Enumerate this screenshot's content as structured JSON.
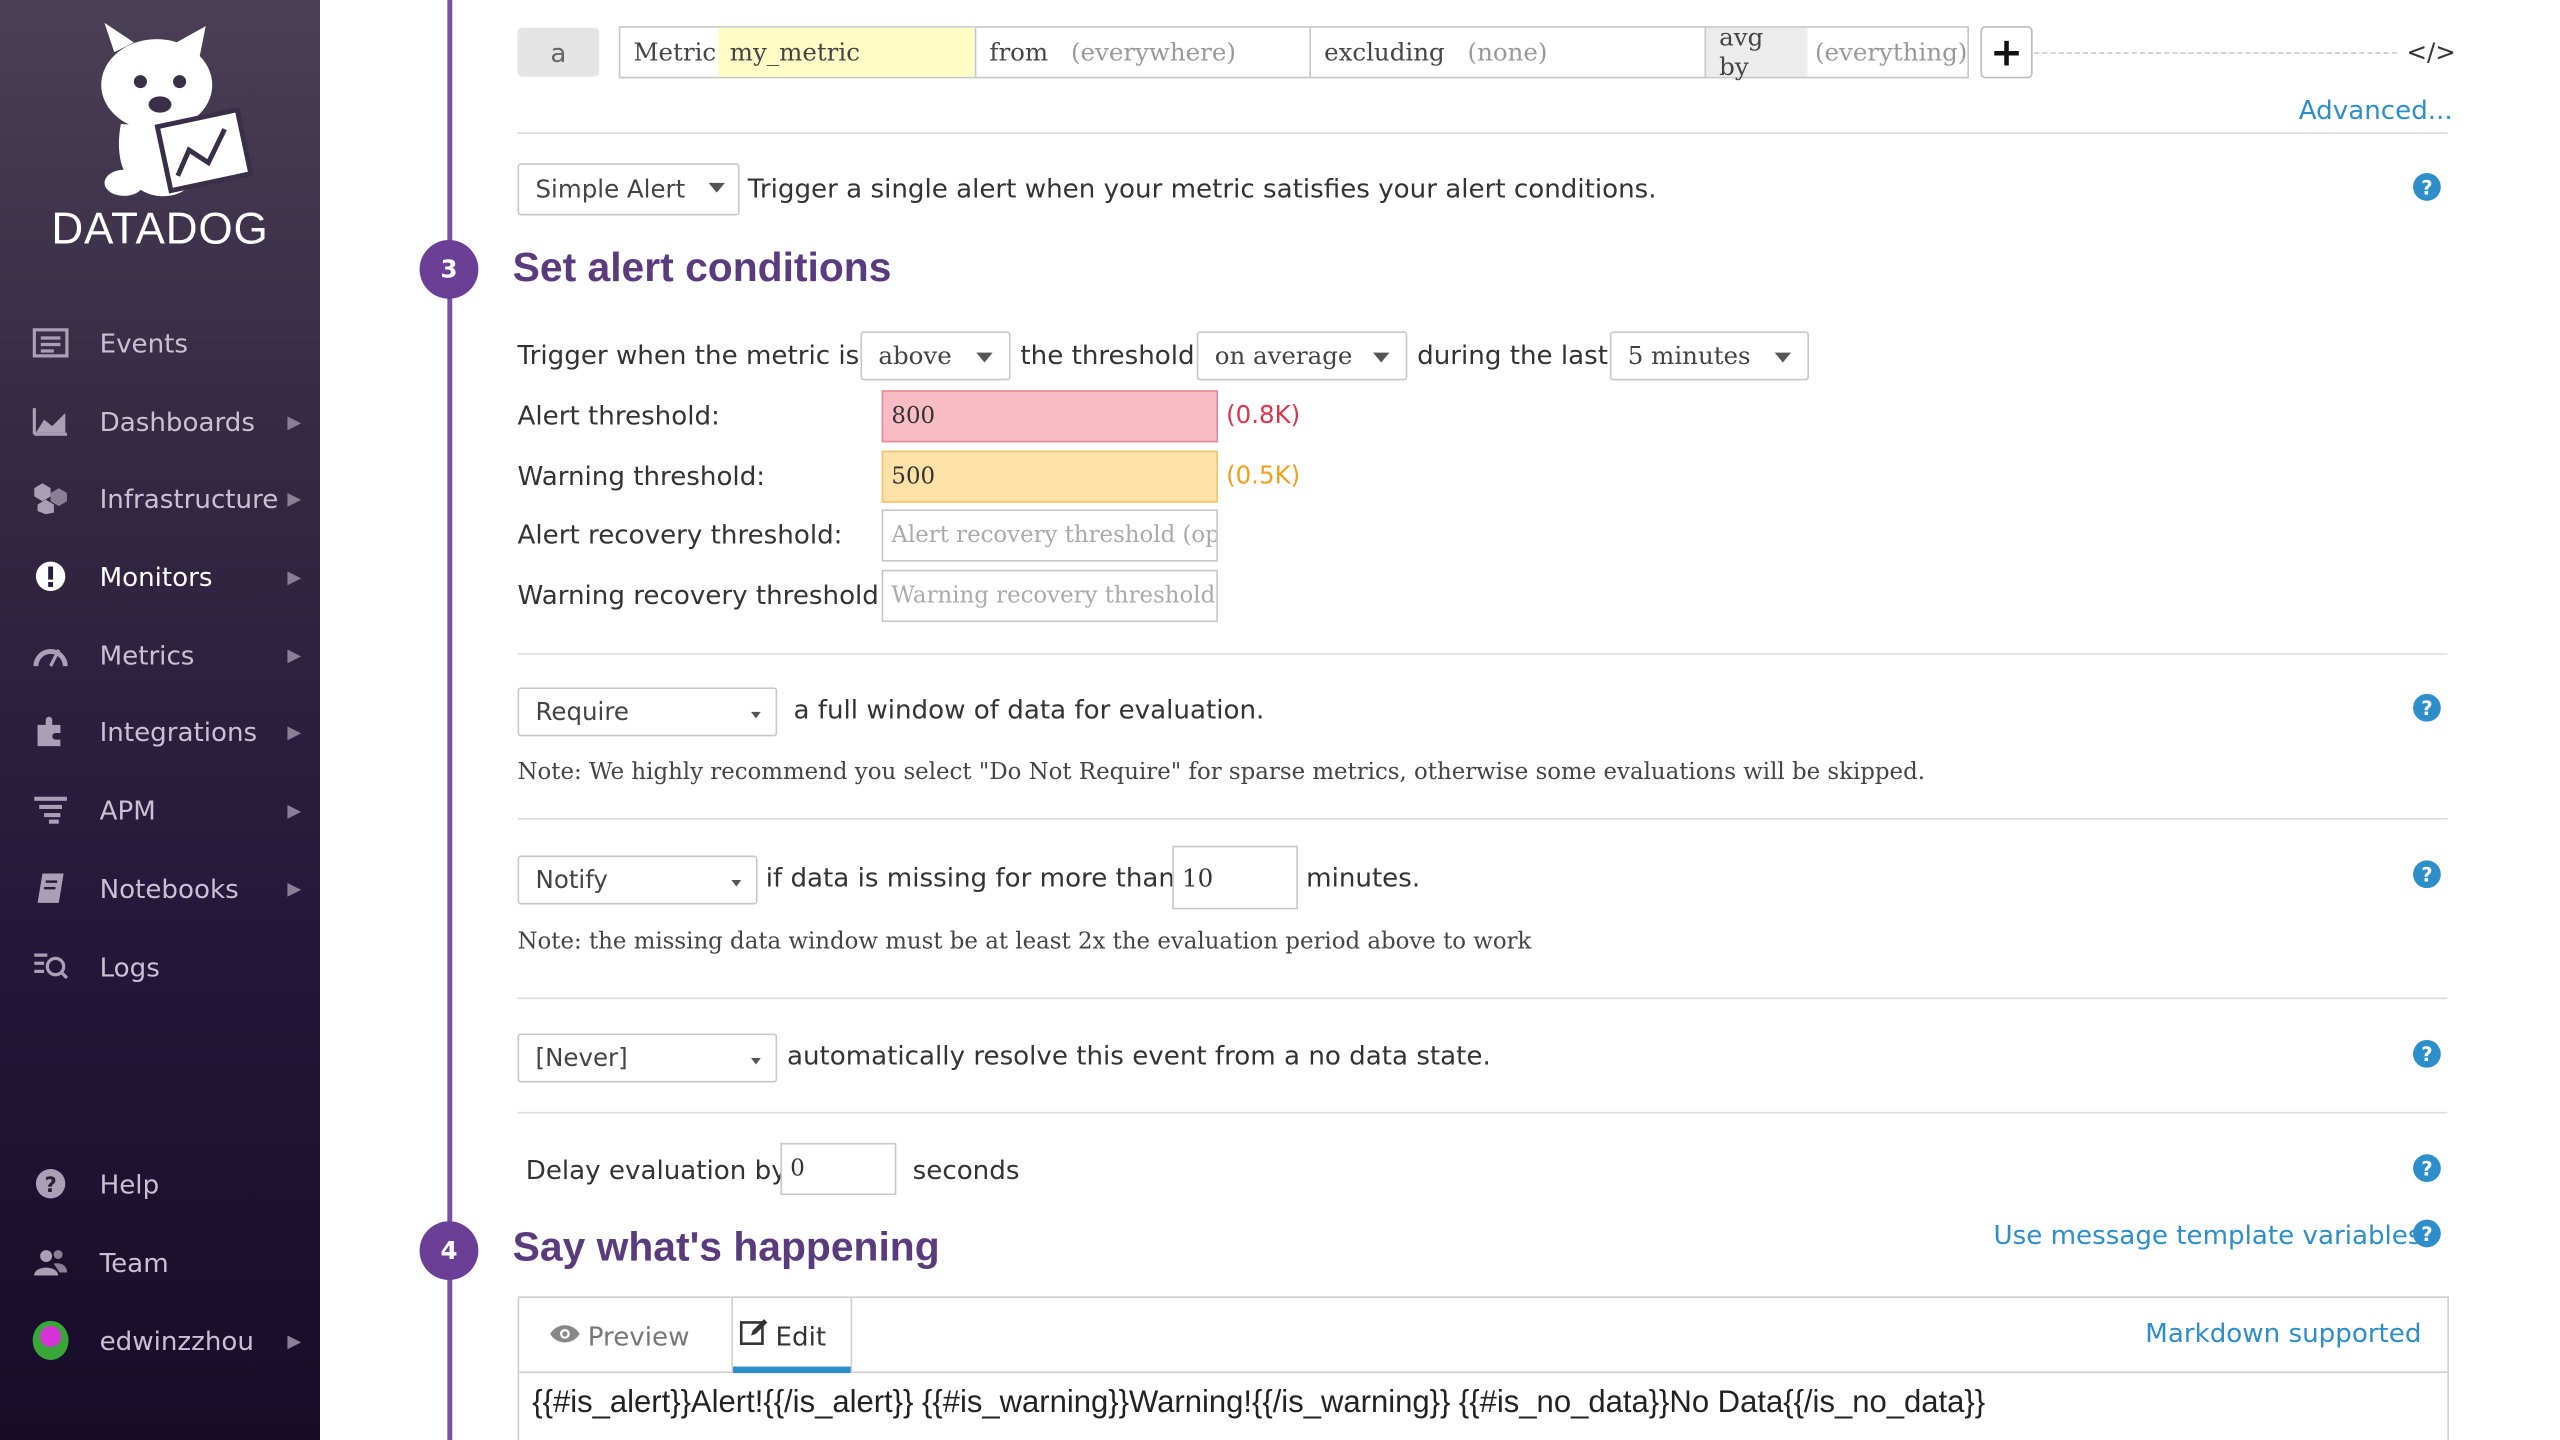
{
  "brand": {
    "name": "DATADOG"
  },
  "sidebar": {
    "items": [
      {
        "label": "Events",
        "icon": "events-icon",
        "chevron": false
      },
      {
        "label": "Dashboards",
        "icon": "dashboards-icon",
        "chevron": true
      },
      {
        "label": "Infrastructure",
        "icon": "infrastructure-icon",
        "chevron": true
      },
      {
        "label": "Monitors",
        "icon": "monitors-icon",
        "chevron": true,
        "active": true
      },
      {
        "label": "Metrics",
        "icon": "metrics-icon",
        "chevron": true
      },
      {
        "label": "Integrations",
        "icon": "integrations-icon",
        "chevron": true
      },
      {
        "label": "APM",
        "icon": "apm-icon",
        "chevron": true
      },
      {
        "label": "Notebooks",
        "icon": "notebooks-icon",
        "chevron": true
      },
      {
        "label": "Logs",
        "icon": "logs-icon",
        "chevron": false
      }
    ],
    "bottom": [
      {
        "label": "Help",
        "icon": "help-icon"
      },
      {
        "label": "Team",
        "icon": "team-icon"
      },
      {
        "label": "edwinzzhou",
        "icon": "user-avatar",
        "chevron": true
      }
    ]
  },
  "query": {
    "letter": "a",
    "metric_label": "Metric",
    "metric_value": "my_metric",
    "from_label": "from",
    "from_value": "(everywhere)",
    "excluding_label": "excluding",
    "excluding_value": "(none)",
    "avgby_label": "avg by",
    "avgby_value": "(everything)",
    "add_button": "+",
    "code_toggle": "</>",
    "advanced_link": "Advanced..."
  },
  "alert_type": {
    "selected": "Simple Alert",
    "description": "Trigger a single alert when your metric satisfies your alert conditions."
  },
  "step3": {
    "number": "3",
    "title": "Set alert conditions",
    "trigger_prefix": "Trigger when the metric is",
    "comparison": "above",
    "threshold_text": "the threshold",
    "aggregation": "on average",
    "during_text": "during the last",
    "window": "5 minutes",
    "alert_threshold_label": "Alert threshold:",
    "alert_threshold_value": "800",
    "alert_threshold_hint": "(0.8K)",
    "warning_threshold_label": "Warning threshold:",
    "warning_threshold_value": "500",
    "warning_threshold_hint": "(0.5K)",
    "alert_recovery_label": "Alert recovery threshold:",
    "alert_recovery_placeholder": "Alert recovery threshold (op",
    "warning_recovery_label": "Warning recovery threshold:",
    "warning_recovery_placeholder": "Warning recovery threshold",
    "require_selected": "Require",
    "require_text": "a full window of data for evaluation.",
    "require_note": "Note: We highly recommend you select \"Do Not Require\" for sparse metrics, otherwise some evaluations will be skipped.",
    "notify_selected": "Notify",
    "notify_text": "if data is missing for more than",
    "notify_minutes": "10",
    "notify_suffix": "minutes.",
    "notify_note": "Note: the missing data window must be at least 2x the evaluation period above to work",
    "resolve_selected": "[Never]",
    "resolve_text": "automatically resolve this event from a no data state.",
    "delay_prefix": "Delay evaluation by",
    "delay_value": "0",
    "delay_suffix": "seconds"
  },
  "step4": {
    "number": "4",
    "title": "Say what's happening",
    "template_link": "Use message template variables",
    "tab_preview": "Preview",
    "tab_edit": "Edit",
    "markdown_link": "Markdown supported",
    "message": "{{#is_alert}}Alert!{{/is_alert}}  {{#is_warning}}Warning!{{/is_warning}}  {{#is_no_data}}No Data{{/is_no_data}}"
  },
  "colors": {
    "sidebar_top": "#4a3f56",
    "sidebar_bottom": "#170c28",
    "accent_purple": "#6b3f96",
    "link_blue": "#2d8ec9",
    "alert_red": "#d9364e",
    "warning_orange": "#f0a020"
  }
}
